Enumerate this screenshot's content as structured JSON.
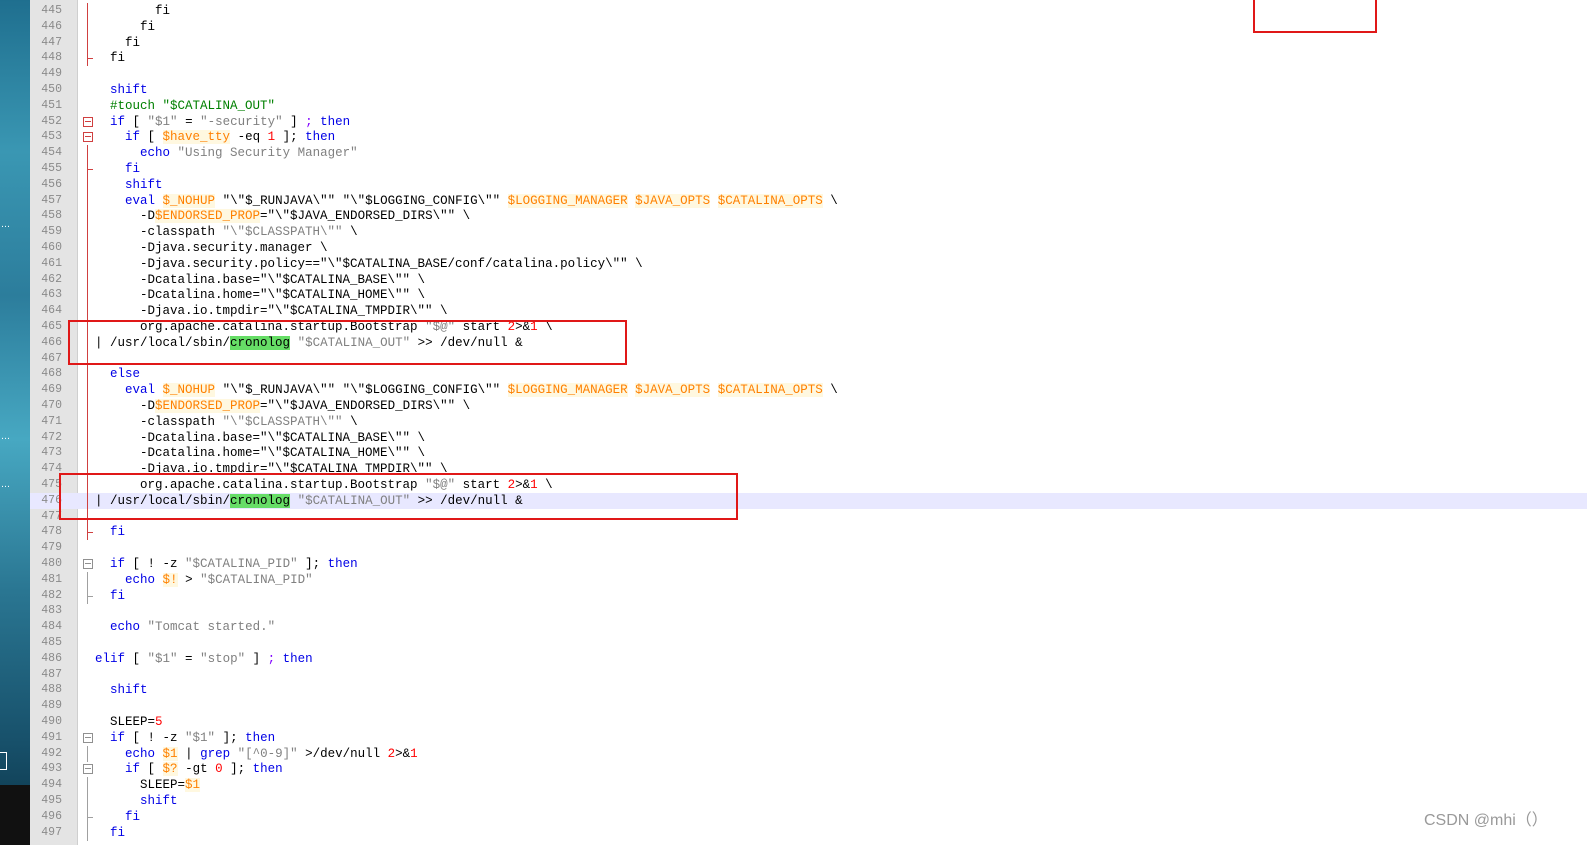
{
  "watermark": "CSDN @mhi（）",
  "lines": [
    {
      "n": 445,
      "fold": "line",
      "t": [
        [
          "        "
        ],
        [
          "fi"
        ]
      ]
    },
    {
      "n": 446,
      "fold": "line",
      "t": [
        [
          "      "
        ],
        [
          "fi"
        ]
      ]
    },
    {
      "n": 447,
      "fold": "line",
      "t": [
        [
          "    "
        ],
        [
          "fi"
        ]
      ]
    },
    {
      "n": 448,
      "fold": "tick",
      "t": [
        [
          "  "
        ],
        [
          "fi"
        ]
      ]
    },
    {
      "n": 449,
      "t": []
    },
    {
      "n": 450,
      "t": [
        [
          "  "
        ],
        [
          "shift",
          "kw"
        ]
      ]
    },
    {
      "n": 451,
      "t": [
        [
          "  "
        ],
        [
          "#touch \"$CATALINA_OUT\"",
          "cmt"
        ]
      ]
    },
    {
      "n": 452,
      "fold": "box",
      "t": [
        [
          "  "
        ],
        [
          "if",
          "kw"
        ],
        [
          " [ "
        ],
        [
          "\"$1\"",
          "str"
        ],
        [
          " = "
        ],
        [
          "\"-security\"",
          "str"
        ],
        [
          " ] "
        ],
        [
          ";",
          "op"
        ],
        [
          " "
        ],
        [
          "then",
          "kw"
        ]
      ]
    },
    {
      "n": 453,
      "fold": "box",
      "t": [
        [
          "    "
        ],
        [
          "if",
          "kw"
        ],
        [
          " [ "
        ],
        [
          "$have_tty",
          "var"
        ],
        [
          " -eq "
        ],
        [
          "1",
          "num"
        ],
        [
          " ]; "
        ],
        [
          "then",
          "kw"
        ]
      ]
    },
    {
      "n": 454,
      "fold": "line",
      "t": [
        [
          "      "
        ],
        [
          "echo",
          "kw"
        ],
        [
          " "
        ],
        [
          "\"Using Security Manager\"",
          "str"
        ]
      ]
    },
    {
      "n": 455,
      "fold": "tick",
      "t": [
        [
          "    "
        ],
        [
          "fi",
          "kw"
        ]
      ]
    },
    {
      "n": 456,
      "fold": "line",
      "t": [
        [
          "    "
        ],
        [
          "shift",
          "kw"
        ]
      ]
    },
    {
      "n": 457,
      "fold": "line",
      "t": [
        [
          "    "
        ],
        [
          "eval",
          "kw"
        ],
        [
          " "
        ],
        [
          "$_NOHUP",
          "var"
        ],
        [
          " \"\\\"$_RUNJAVA\\\"\" \"\\\"$LOGGING_CONFIG\\\"\" "
        ],
        [
          "$LOGGING_MANAGER",
          "var"
        ],
        [
          " "
        ],
        [
          "$JAVA_OPTS",
          "var"
        ],
        [
          " "
        ],
        [
          "$CATALINA_OPTS",
          "var"
        ],
        [
          " \\"
        ]
      ]
    },
    {
      "n": 458,
      "fold": "line",
      "t": [
        [
          "      -D"
        ],
        [
          "$ENDORSED_PROP",
          "var"
        ],
        [
          "=\"\\\"$JAVA_ENDORSED_DIRS\\\"\" \\"
        ]
      ]
    },
    {
      "n": 459,
      "fold": "line",
      "t": [
        [
          "      -classpath "
        ],
        [
          "\"\\\"$CLASSPATH\\\"\"",
          "str"
        ],
        [
          " \\"
        ]
      ]
    },
    {
      "n": 460,
      "fold": "line",
      "t": [
        [
          "      -Djava.security.manager \\"
        ]
      ]
    },
    {
      "n": 461,
      "fold": "line",
      "t": [
        [
          "      -Djava.security.policy==\"\\\"$CATALINA_BASE/conf/catalina.policy\\\"\" \\"
        ]
      ]
    },
    {
      "n": 462,
      "fold": "line",
      "t": [
        [
          "      -Dcatalina.base=\"\\\"$CATALINA_BASE\\\"\" \\"
        ]
      ]
    },
    {
      "n": 463,
      "fold": "line",
      "t": [
        [
          "      -Dcatalina.home=\"\\\"$CATALINA_HOME\\\"\" \\"
        ]
      ]
    },
    {
      "n": 464,
      "fold": "line",
      "t": [
        [
          "      -Djava.io.tmpdir=\"\\\"$CATALINA_TMPDIR\\\"\" \\"
        ]
      ]
    },
    {
      "n": 465,
      "fold": "line",
      "t": [
        [
          "      org.apache.catalina.startup.Bootstrap "
        ],
        [
          "\"$@\"",
          "str"
        ],
        [
          " start "
        ],
        [
          "2",
          "num"
        ],
        [
          ">&"
        ],
        [
          "1",
          "num"
        ],
        [
          " \\"
        ]
      ]
    },
    {
      "n": 466,
      "fold": "line",
      "t": [
        [
          "| /usr/local/sbin/"
        ],
        [
          "cronolog",
          "hl"
        ],
        [
          " "
        ],
        [
          "\"$CATALINA_OUT\"",
          "str"
        ],
        [
          " >> /dev/null &"
        ]
      ]
    },
    {
      "n": 467,
      "fold": "line",
      "t": []
    },
    {
      "n": 468,
      "fold": "line",
      "t": [
        [
          "  "
        ],
        [
          "else",
          "kw"
        ]
      ]
    },
    {
      "n": 469,
      "fold": "line",
      "t": [
        [
          "    "
        ],
        [
          "eval",
          "kw"
        ],
        [
          " "
        ],
        [
          "$_NOHUP",
          "var"
        ],
        [
          " \"\\\"$_RUNJAVA\\\"\" \"\\\"$LOGGING_CONFIG\\\"\" "
        ],
        [
          "$LOGGING_MANAGER",
          "var"
        ],
        [
          " "
        ],
        [
          "$JAVA_OPTS",
          "var"
        ],
        [
          " "
        ],
        [
          "$CATALINA_OPTS",
          "var"
        ],
        [
          " \\"
        ]
      ]
    },
    {
      "n": 470,
      "fold": "line",
      "t": [
        [
          "      -D"
        ],
        [
          "$ENDORSED_PROP",
          "var"
        ],
        [
          "=\"\\\"$JAVA_ENDORSED_DIRS\\\"\" \\"
        ]
      ]
    },
    {
      "n": 471,
      "fold": "line",
      "t": [
        [
          "      -classpath "
        ],
        [
          "\"\\\"$CLASSPATH\\\"\"",
          "str"
        ],
        [
          " \\"
        ]
      ]
    },
    {
      "n": 472,
      "fold": "line",
      "t": [
        [
          "      -Dcatalina.base=\"\\\"$CATALINA_BASE\\\"\" \\"
        ]
      ]
    },
    {
      "n": 473,
      "fold": "line",
      "t": [
        [
          "      -Dcatalina.home=\"\\\"$CATALINA_HOME\\\"\" \\"
        ]
      ]
    },
    {
      "n": 474,
      "fold": "line",
      "t": [
        [
          "      -Djava.io.tmpdir=\"\\\"$CATALINA_TMPDIR\\\"\" \\"
        ]
      ]
    },
    {
      "n": 475,
      "fold": "line",
      "t": [
        [
          "      org.apache.catalina.startup.Bootstrap "
        ],
        [
          "\"$@\"",
          "str"
        ],
        [
          " start "
        ],
        [
          "2",
          "num"
        ],
        [
          ">&"
        ],
        [
          "1",
          "num"
        ],
        [
          " \\"
        ]
      ]
    },
    {
      "n": 476,
      "fold": "line",
      "current": true,
      "t": [
        [
          "| /usr/local/sbin/"
        ],
        [
          "cronolog",
          "hl"
        ],
        [
          " "
        ],
        [
          "\"$CATALINA_OUT\"",
          "str"
        ],
        [
          " >> /dev/null &"
        ]
      ]
    },
    {
      "n": 477,
      "fold": "line",
      "t": []
    },
    {
      "n": 478,
      "fold": "tick",
      "t": [
        [
          "  "
        ],
        [
          "fi",
          "kw"
        ]
      ]
    },
    {
      "n": 479,
      "t": []
    },
    {
      "n": 480,
      "fold": "boxgray",
      "t": [
        [
          "  "
        ],
        [
          "if",
          "kw"
        ],
        [
          " [ ! -z "
        ],
        [
          "\"$CATALINA_PID\"",
          "str"
        ],
        [
          " ]; "
        ],
        [
          "then",
          "kw"
        ]
      ]
    },
    {
      "n": 481,
      "fold": "linegray",
      "t": [
        [
          "    "
        ],
        [
          "echo",
          "kw"
        ],
        [
          " "
        ],
        [
          "$!",
          "var"
        ],
        [
          " > "
        ],
        [
          "\"$CATALINA_PID\"",
          "str"
        ]
      ]
    },
    {
      "n": 482,
      "fold": "tickgray",
      "t": [
        [
          "  "
        ],
        [
          "fi",
          "kw"
        ]
      ]
    },
    {
      "n": 483,
      "t": []
    },
    {
      "n": 484,
      "t": [
        [
          "  "
        ],
        [
          "echo",
          "kw"
        ],
        [
          " "
        ],
        [
          "\"Tomcat started.\"",
          "str"
        ]
      ]
    },
    {
      "n": 485,
      "t": []
    },
    {
      "n": 486,
      "t": [
        [
          "elif",
          "kw"
        ],
        [
          " [ "
        ],
        [
          "\"$1\"",
          "str"
        ],
        [
          " = "
        ],
        [
          "\"stop\"",
          "str"
        ],
        [
          " ] "
        ],
        [
          ";",
          "op"
        ],
        [
          " "
        ],
        [
          "then",
          "kw"
        ]
      ]
    },
    {
      "n": 487,
      "t": []
    },
    {
      "n": 488,
      "t": [
        [
          "  "
        ],
        [
          "shift",
          "kw"
        ]
      ]
    },
    {
      "n": 489,
      "t": []
    },
    {
      "n": 490,
      "t": [
        [
          "  SLEEP="
        ],
        [
          "5",
          "num"
        ]
      ]
    },
    {
      "n": 491,
      "fold": "boxgray",
      "t": [
        [
          "  "
        ],
        [
          "if",
          "kw"
        ],
        [
          " [ ! -z "
        ],
        [
          "\"$1\"",
          "str"
        ],
        [
          " ]; "
        ],
        [
          "then",
          "kw"
        ]
      ]
    },
    {
      "n": 492,
      "fold": "linegray",
      "t": [
        [
          "    "
        ],
        [
          "echo",
          "kw"
        ],
        [
          " "
        ],
        [
          "$1",
          "var"
        ],
        [
          " | "
        ],
        [
          "grep",
          "kw"
        ],
        [
          " "
        ],
        [
          "\"[^0-9]\"",
          "str"
        ],
        [
          " >/dev/null "
        ],
        [
          "2",
          "num"
        ],
        [
          ">&"
        ],
        [
          "1",
          "num"
        ]
      ]
    },
    {
      "n": 493,
      "fold": "boxgray",
      "t": [
        [
          "    "
        ],
        [
          "if",
          "kw"
        ],
        [
          " [ "
        ],
        [
          "$?",
          "var"
        ],
        [
          " -gt "
        ],
        [
          "0",
          "num"
        ],
        [
          " ]; "
        ],
        [
          "then",
          "kw"
        ]
      ]
    },
    {
      "n": 494,
      "fold": "linegray",
      "t": [
        [
          "      SLEEP="
        ],
        [
          "$1",
          "var"
        ]
      ]
    },
    {
      "n": 495,
      "fold": "linegray",
      "t": [
        [
          "      "
        ],
        [
          "shift",
          "kw"
        ]
      ]
    },
    {
      "n": 496,
      "fold": "tickgray",
      "t": [
        [
          "    "
        ],
        [
          "fi",
          "kw"
        ]
      ]
    },
    {
      "n": 497,
      "fold": "linegray",
      "t": [
        [
          "  "
        ],
        [
          "fi",
          "kw"
        ]
      ]
    }
  ]
}
